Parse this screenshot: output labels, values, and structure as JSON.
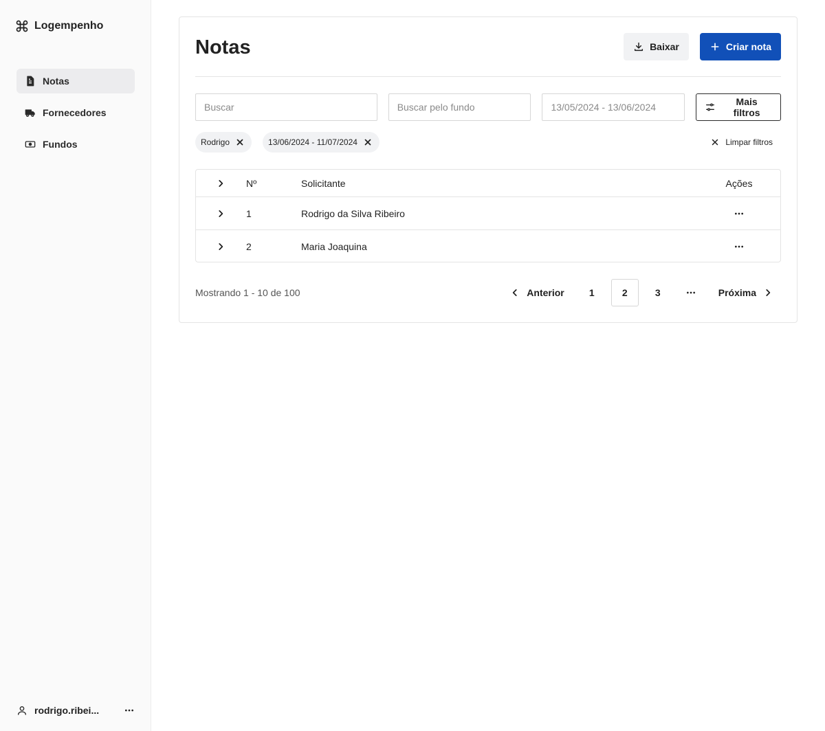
{
  "brand": {
    "name": "Logempenho",
    "icon": "command-icon"
  },
  "sidebar": {
    "items": [
      {
        "label": "Notas",
        "icon": "document-icon",
        "active": true
      },
      {
        "label": "Fornecedores",
        "icon": "truck-icon",
        "active": false
      },
      {
        "label": "Fundos",
        "icon": "cash-icon",
        "active": false
      }
    ],
    "user": {
      "name": "rodrigo.ribei...",
      "icon": "user-icon"
    }
  },
  "header": {
    "title": "Notas",
    "download_label": "Baixar",
    "create_label": "Criar nota"
  },
  "filters": {
    "search_placeholder": "Buscar",
    "fund_placeholder": "Buscar pelo fundo",
    "date_placeholder": "13/05/2024 - 13/06/2024",
    "more_filters_label": "Mais filtros"
  },
  "chips": [
    {
      "label": "Rodrigo"
    },
    {
      "label": "13/06/2024 - 11/07/2024"
    }
  ],
  "clear_filters_label": "Limpar filtros",
  "table": {
    "columns": {
      "number": "Nº",
      "requester": "Solicitante",
      "actions": "Ações"
    },
    "rows": [
      {
        "number": "1",
        "requester": "Rodrigo da Silva Ribeiro"
      },
      {
        "number": "2",
        "requester": "Maria Joaquina"
      }
    ]
  },
  "pagination": {
    "showing": "Mostrando 1 - 10 de 100",
    "previous": "Anterior",
    "next": "Próxima",
    "pages": [
      "1",
      "2",
      "3"
    ],
    "current": "2"
  },
  "colors": {
    "primary": "#1150b8",
    "sidebar_bg": "#fafafa",
    "chip_bg": "#f1f2f4"
  }
}
